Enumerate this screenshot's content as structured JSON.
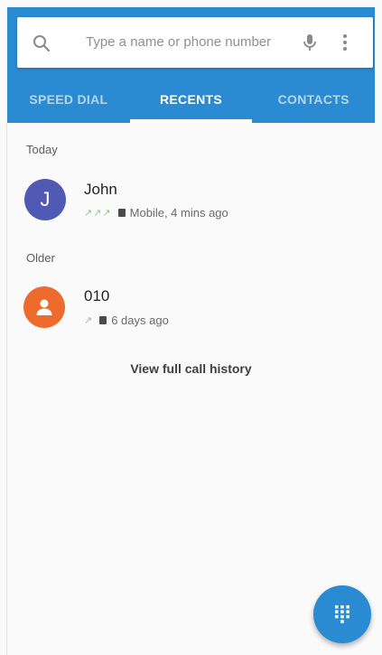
{
  "search": {
    "placeholder": "Type a name or phone number",
    "search_icon": "search-icon",
    "mic_icon": "mic-icon",
    "more_icon": "more-vert-icon"
  },
  "tabs": [
    {
      "label": "SPEED DIAL",
      "active": false
    },
    {
      "label": "RECENTS",
      "active": true
    },
    {
      "label": "CONTACTS",
      "active": false
    }
  ],
  "recents": {
    "sections": [
      {
        "label": "Today",
        "entries": [
          {
            "avatar_letter": "J",
            "avatar_color": "#5059b4",
            "name": "John",
            "call_icons": "↗↗↗",
            "detail": "Mobile, 4 mins ago"
          }
        ]
      },
      {
        "label": "Older",
        "entries": [
          {
            "avatar_icon": "person-icon",
            "avatar_color": "#ee6b2e",
            "name": "010",
            "call_icons": "↗",
            "detail": "6 days ago"
          }
        ]
      }
    ],
    "view_history_label": "View full call history"
  },
  "fab": {
    "icon": "dialpad-icon"
  },
  "colors": {
    "primary": "#2a8bd2",
    "background": "#fafafa"
  }
}
